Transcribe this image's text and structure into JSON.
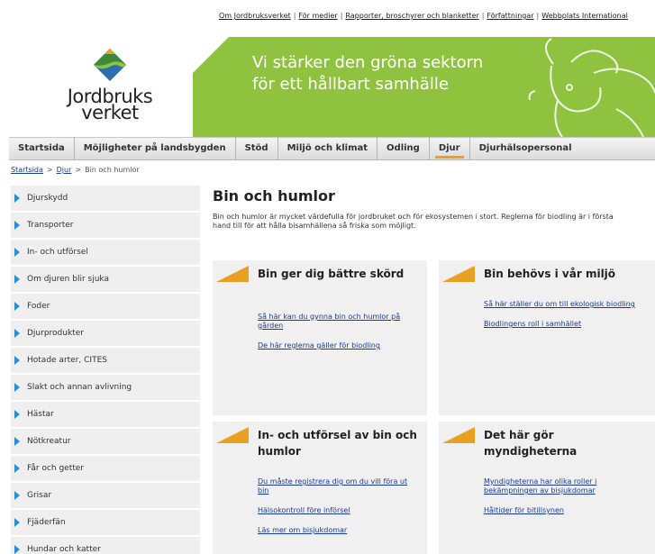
{
  "top_links": [
    "Om Jordbruksverket",
    "För medier",
    "Rapporter, broschyrer och blanketter",
    "Författningar",
    "Webbplats International"
  ],
  "logo": {
    "line1": "Jordbruks",
    "line2": "verket"
  },
  "banner": {
    "line1": "Vi stärker den gröna sektorn",
    "line2": "för ett hållbart samhälle"
  },
  "main_nav": [
    {
      "label": "Startsida"
    },
    {
      "label": "Möjligheter på landsbygden"
    },
    {
      "label": "Stöd"
    },
    {
      "label": "Miljö och klimat"
    },
    {
      "label": "Odling"
    },
    {
      "label": "Djur",
      "active": true
    },
    {
      "label": "Djurhälsopersonal"
    }
  ],
  "breadcrumb": {
    "home": "Startsida",
    "parent": "Djur",
    "current": "Bin och humlor"
  },
  "sidebar": [
    "Djurskydd",
    "Transporter",
    "In- och utförsel",
    "Om djuren blir sjuka",
    "Foder",
    "Djurprodukter",
    "Hotade arter, CITES",
    "Slakt och annan avlivning",
    "Hästar",
    "Nötkreatur",
    "Får och getter",
    "Grisar",
    "Fjäderfän",
    "Hundar och katter"
  ],
  "page": {
    "title": "Bin och humlor",
    "intro": "Bin och humlor är mycket värdefulla för jordbruket och för ekosystemen i stort. Reglerna för biodling är i första hand till för att hålla bisamhällena så friska som möjligt."
  },
  "cards": [
    {
      "title": "Bin ger dig bättre skörd",
      "links": [
        "Så här kan du gynna bin och humlor på gården",
        "De här reglerna gäller för biodling"
      ]
    },
    {
      "title": "Bin behövs i vår miljö",
      "links": [
        "Så här ställer du om till ekologisk biodling",
        "Biodlingens roll i samhället"
      ]
    },
    {
      "title": "In- och utförsel av bin och humlor",
      "links": [
        "Du måste registrera dig om du vill föra ut bin",
        "Hälsokontroll före införsel",
        "Läs mer om bisjukdomar"
      ]
    },
    {
      "title": "Det här gör myndigheterna",
      "links": [
        "Myndigheterna har olika roller i bekämpningen av bisjukdomar",
        "Håltider för bitillsynen"
      ]
    }
  ],
  "colors": {
    "banner_green": "#8fc23f",
    "accent_orange": "#e8a020",
    "link_blue": "#1a3a9a",
    "arrow_blue": "#2a8fd0"
  }
}
